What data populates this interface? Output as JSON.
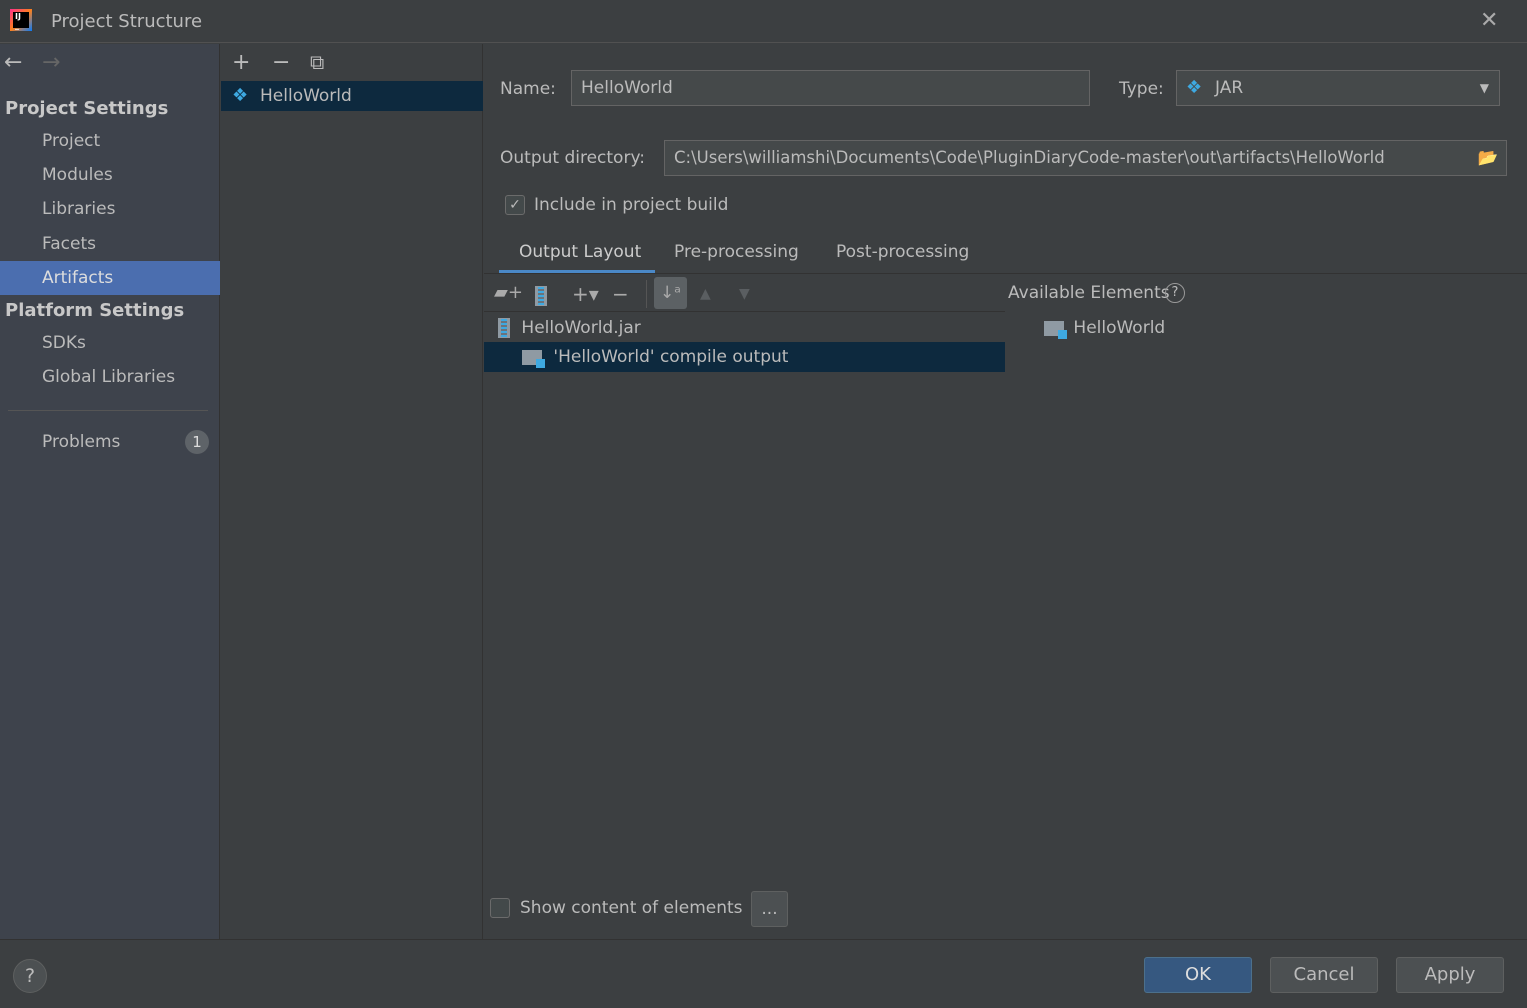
{
  "window": {
    "title": "Project Structure"
  },
  "sidebar": {
    "project_settings": "Project Settings",
    "items": [
      {
        "label": "Project"
      },
      {
        "label": "Modules"
      },
      {
        "label": "Libraries"
      },
      {
        "label": "Facets"
      },
      {
        "label": "Artifacts",
        "selected": true
      }
    ],
    "platform_settings": "Platform Settings",
    "platform_items": [
      {
        "label": "SDKs"
      },
      {
        "label": "Global Libraries"
      }
    ],
    "problems": {
      "label": "Problems",
      "count": "1"
    }
  },
  "artifacts": {
    "list": [
      {
        "name": "HelloWorld",
        "selected": true
      }
    ]
  },
  "detail": {
    "name_label": "Name:",
    "name_value": "HelloWorld",
    "type_label": "Type:",
    "type_value": "JAR",
    "output_label": "Output directory:",
    "output_value": "C:\\Users\\williamshi\\Documents\\Code\\PluginDiaryCode-master\\out\\artifacts\\HelloWorld",
    "include_label": "Include in project build",
    "include_checked": true,
    "tabs": [
      {
        "label": "Output Layout",
        "active": true
      },
      {
        "label": "Pre-processing"
      },
      {
        "label": "Post-processing"
      }
    ],
    "layout_tree": [
      {
        "label": "HelloWorld.jar"
      },
      {
        "label": "'HelloWorld' compile output",
        "selected": true
      }
    ],
    "available_label": "Available Elements",
    "available": [
      {
        "label": "HelloWorld"
      }
    ],
    "show_content_label": "Show content of elements",
    "show_content_checked": false,
    "ellipsis": "..."
  },
  "footer": {
    "help": "?",
    "ok": "OK",
    "cancel": "Cancel",
    "apply": "Apply"
  },
  "colors": {
    "accent": "#4b6eaf",
    "selection": "#0d293e",
    "tab_underline": "#4a88c7"
  }
}
